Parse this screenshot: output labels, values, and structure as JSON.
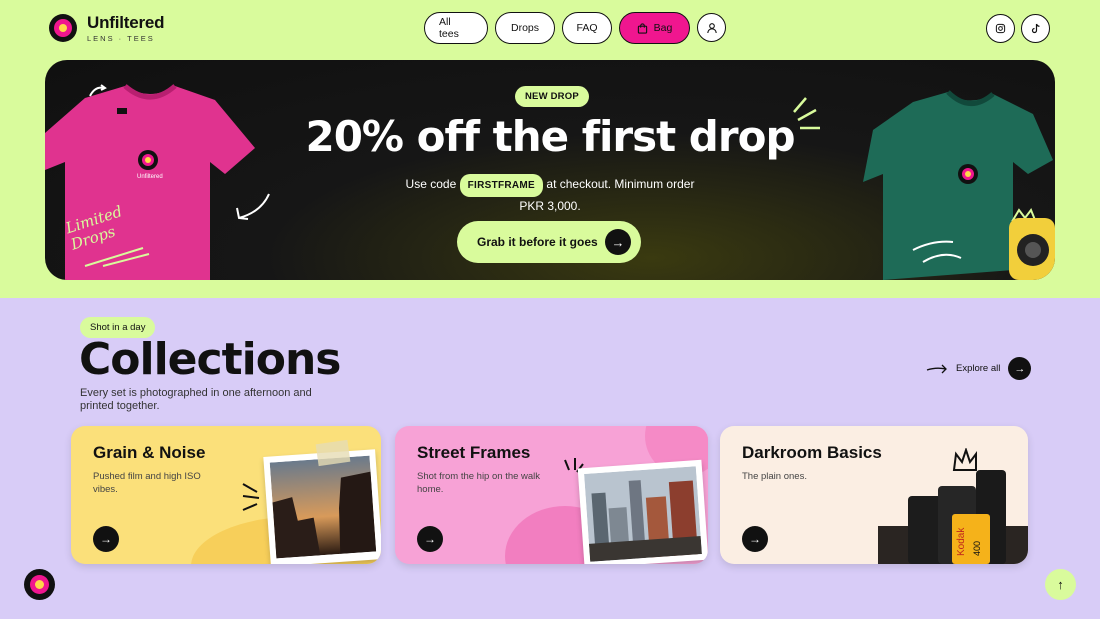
{
  "brand": {
    "name": "Unfiltered",
    "tagline": "LENS · TEES"
  },
  "nav": {
    "all_tees": "All tees",
    "drops": "Drops",
    "faq": "FAQ",
    "bag": "Bag"
  },
  "icons": {
    "user": "user-icon",
    "bag": "bag-icon",
    "instagram": "instagram-icon",
    "tiktok": "tiktok-icon"
  },
  "hero": {
    "badge": "NEW DROP",
    "title": "20% off the first drop",
    "sub_before": "Use code",
    "code": "FIRSTFRAME",
    "sub_after": "at checkout. Minimum order PKR 3,000.",
    "cta": "Grab it before it goes",
    "tee_label": "Limited Drops"
  },
  "collections": {
    "tag": "Shot in a day",
    "title": "Collections",
    "description": "Every set is photographed in one afternoon and printed together.",
    "explore": "Explore all",
    "cards": [
      {
        "title": "Grain & Noise",
        "desc": "Pushed film and high ISO vibes."
      },
      {
        "title": "Street Frames",
        "desc": "Shot from the hip on the walk home."
      },
      {
        "title": "Darkroom Basics",
        "desc": "The plain ones."
      }
    ]
  },
  "colors": {
    "lime": "#d9fb9c",
    "pink": "#f0168f",
    "lavender": "#d8ccf7",
    "dark": "#111111"
  }
}
